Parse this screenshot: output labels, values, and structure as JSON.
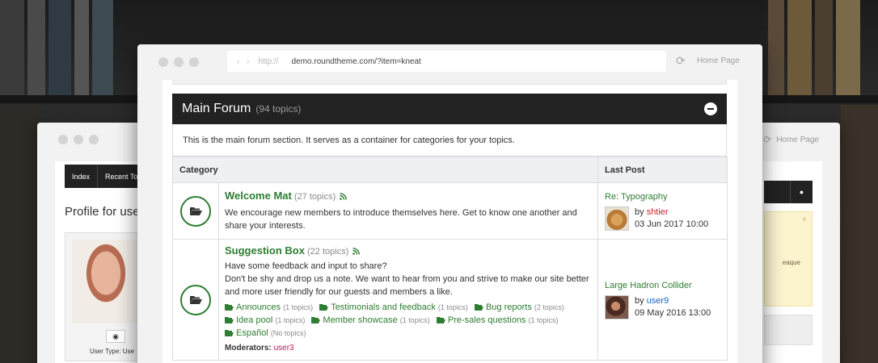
{
  "colors": {
    "accent_green": "#2e7d32",
    "header_dark": "#222222",
    "user_red": "#c62828",
    "user_blue": "#1565c0",
    "moderator_pink": "#c2185b"
  },
  "back_window": {
    "home_label": "Home Page",
    "nav": [
      "Index",
      "Recent Top"
    ],
    "profile_title": "Profile for user",
    "user_type_label": "User Type: Use",
    "notice_text": "eaque"
  },
  "browser": {
    "protocol": "http://",
    "url": "demo.roundtheme.com/?item=kneat",
    "home_label": "Home Page"
  },
  "forum": {
    "title": "Main Forum",
    "topic_count": "(94 topics)",
    "description": "This is the main forum section. It serves as a container for categories for your topics.",
    "headers": {
      "category": "Category",
      "last_post": "Last Post"
    },
    "categories": [
      {
        "title": "Welcome Mat",
        "count": "(27 topics)",
        "description": "We encourage new members to introduce themselves here. Get to know one another and share your interests.",
        "last_post": {
          "title": "Re: Typography",
          "by": "by",
          "user": "shtier",
          "date": "03 Jun 2017 10:00"
        }
      },
      {
        "title": "Suggestion Box",
        "count": "(22 topics)",
        "description_lines": [
          "Have some feedback and input to share?",
          "Don't be shy and drop us a note. We want to hear from you and strive to make our site better and more user friendly for our guests and members a like."
        ],
        "subforums": [
          {
            "name": "Announces",
            "count": "(1 topics)"
          },
          {
            "name": "Testimonials and feedback",
            "count": "(1 topics)"
          },
          {
            "name": "Bug reports",
            "count": "(2 topics)"
          },
          {
            "name": "Idea pool",
            "count": "(1 topics)"
          },
          {
            "name": "Member showcase",
            "count": "(1 topics)"
          },
          {
            "name": "Pre-sales questions",
            "count": "(1 topics)"
          },
          {
            "name": "Español",
            "count": "(No topics)"
          }
        ],
        "moderators_label": "Moderators:",
        "moderator": "user3",
        "last_post": {
          "title": "Large Hadron Collider",
          "by": "by",
          "user": "user9",
          "date": "09 May 2016 13:00"
        }
      }
    ]
  }
}
